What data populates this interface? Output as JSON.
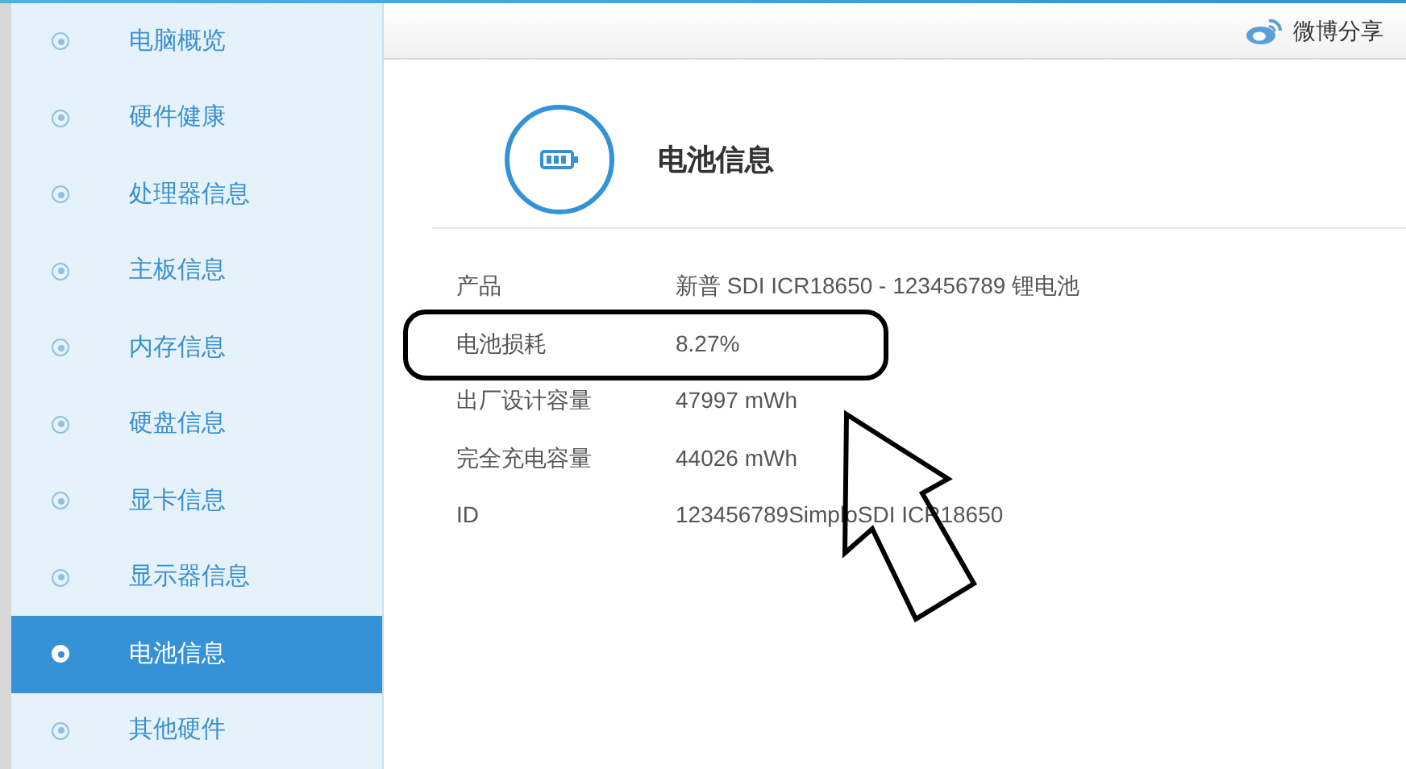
{
  "sidebar": {
    "items": [
      {
        "label": "电脑概览",
        "selected": false
      },
      {
        "label": "硬件健康",
        "selected": false
      },
      {
        "label": "处理器信息",
        "selected": false
      },
      {
        "label": "主板信息",
        "selected": false
      },
      {
        "label": "内存信息",
        "selected": false
      },
      {
        "label": "硬盘信息",
        "selected": false
      },
      {
        "label": "显卡信息",
        "selected": false
      },
      {
        "label": "显示器信息",
        "selected": false
      },
      {
        "label": "电池信息",
        "selected": true
      },
      {
        "label": "其他硬件",
        "selected": false
      }
    ]
  },
  "header": {
    "share": "微博分享"
  },
  "section": {
    "title": "电池信息"
  },
  "rows": [
    {
      "label": "产品",
      "value": "新普 SDI ICR18650 - 123456789 锂电池",
      "highlighted": false
    },
    {
      "label": "电池损耗",
      "value": "8.27%",
      "highlighted": true
    },
    {
      "label": "出厂设计容量",
      "value": "47997 mWh",
      "highlighted": false
    },
    {
      "label": "完全充电容量",
      "value": "44026 mWh",
      "highlighted": false
    },
    {
      "label": "ID",
      "value": "123456789SimploSDI ICR18650",
      "highlighted": false
    }
  ]
}
